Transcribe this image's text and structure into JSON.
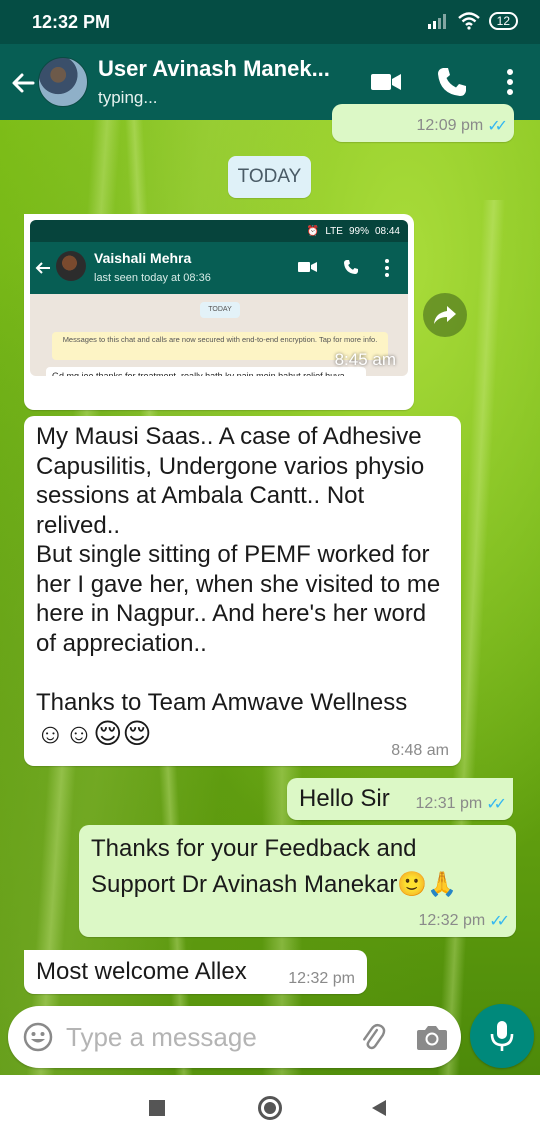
{
  "status_bar": {
    "time": "12:32 PM",
    "battery": "12"
  },
  "header": {
    "contact_name": "User Avinash Manek...",
    "status": "typing..."
  },
  "date_chip": "TODAY",
  "prev_message": {
    "time": "12:09 pm"
  },
  "forwarded_image": {
    "status_time": "08:44",
    "battery": "99%",
    "network": "LTE",
    "contact_name": "Vaishali Mehra",
    "last_seen": "last seen today at 08:36",
    "today_label": "TODAY",
    "encryption_notice": "Messages to this chat and calls are now secured with end-to-end encryption. Tap for more info.",
    "message": "Gd mg  jee thanks for treatment .really hath ky pain mein bahut relief huva.",
    "time": "8:45 am"
  },
  "messages": [
    {
      "lines": [
        "My Mausi Saas.. A case of Adhesive",
        "Capusilitis, Undergone varios physio",
        "sessions at Ambala Cantt.. Not",
        "relived..",
        "But single sitting of PEMF worked for",
        "her I gave her, when she visited to me",
        "here in Nagpur.. And here's her word",
        "of appreciation..",
        "",
        "Thanks to Team Amwave Wellness",
        "☺☺😌😌"
      ],
      "time": "8:48 am"
    },
    {
      "text": "Hello Sir",
      "time": "12:31 pm"
    },
    {
      "lines": [
        "Thanks for your Feedback and",
        "Support Dr Avinash Manekar🙂🙏"
      ],
      "time": "12:32 pm"
    },
    {
      "text": "Most welcome Allex",
      "time": "12:32 pm"
    }
  ],
  "input": {
    "placeholder": "Type a message"
  },
  "icons": {
    "back": "back-arrow-icon",
    "video": "video-call-icon",
    "call": "phone-icon",
    "menu": "more-vert-icon",
    "emoji": "emoji-icon",
    "attach": "paperclip-icon",
    "camera": "camera-icon",
    "mic": "mic-icon",
    "forward": "forward-icon",
    "read": "double-check-icon"
  },
  "colors": {
    "header": "#075e54",
    "status_bar": "#054d44",
    "outgoing_bubble": "#dcf8c6",
    "incoming_bubble": "#ffffff",
    "mic_button": "#00897b",
    "read_ticks": "#34b7f1"
  }
}
